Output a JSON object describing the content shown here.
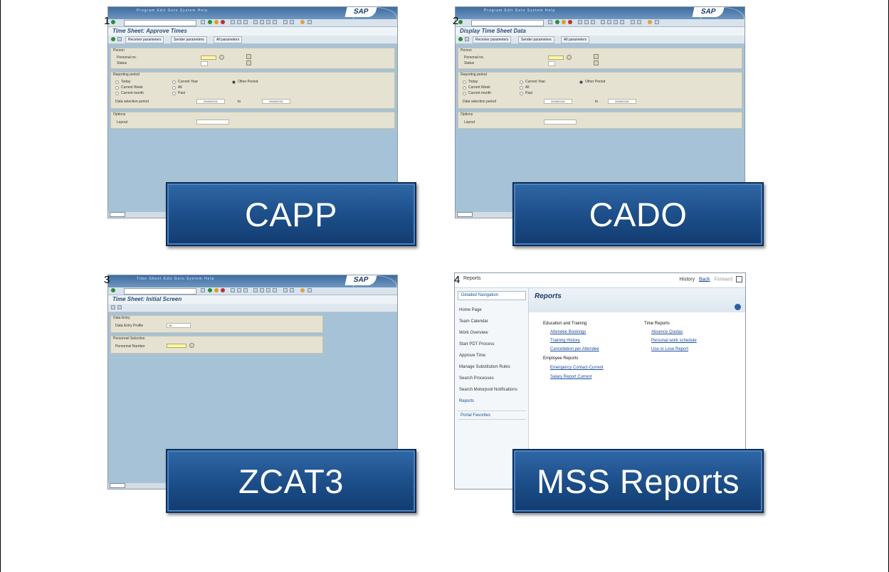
{
  "panels": [
    {
      "number": "1",
      "app": {
        "menu": "Program  Edit  Goto  System  Help",
        "logo": "SAP",
        "title": "Time Sheet: Approve Times",
        "buttons": [
          "Receiver parameters",
          "Sender parameters",
          "All parameters"
        ],
        "person_frame": "Person",
        "personal_no": "Personal no.",
        "status": "Status",
        "period_frame": "Reporting period",
        "options": [
          "Today",
          "Current Week",
          "Current month",
          "Current Year",
          "All",
          "Past",
          "Other Period"
        ],
        "selection_label": "Data selection period",
        "date_from": "09/26/2011",
        "to": "to",
        "date_to": "09/26/2011",
        "options_frame": "Options",
        "layout": "Layout"
      },
      "label": "CAPP"
    },
    {
      "number": "2",
      "app": {
        "menu": "Program  Edit  Goto  System  Help",
        "logo": "SAP",
        "title": "Display Time Sheet Data",
        "buttons": [
          "Receiver parameters",
          "Sender parameters",
          "All parameters"
        ],
        "person_frame": "Person",
        "personal_no": "Personal no.",
        "status": "Status",
        "period_frame": "Reporting period",
        "options": [
          "Today",
          "Current Week",
          "Current month",
          "Current Year",
          "All",
          "Past",
          "Other Period"
        ],
        "selection_label": "Data selection period",
        "date_from": "09/26/2011",
        "to": "to",
        "date_to": "09/26/2011",
        "options_frame": "Options",
        "layout": "Layout"
      },
      "label": "CADO"
    },
    {
      "number": "3",
      "app": {
        "menu": "Time Sheet  Edit  Goto  System  Help",
        "logo": "SAP",
        "title": "Time Sheet: Initial Screen",
        "entry_frame": "Data Entry",
        "profile_label": "Data Entry Profile",
        "profile_value": "08",
        "selection_frame": "Personnel Selection",
        "personnel_label": "Personnel Number"
      },
      "label": "ZCAT3"
    },
    {
      "number": "4",
      "portal": {
        "header_title": "Reports",
        "history": "History",
        "back": "Back",
        "forward": "Forward",
        "detailed_navigation": "Detailed Navigation",
        "nav": [
          "Home Page",
          "Team Calendar",
          "Work Overview",
          "Start PDT Process",
          "Approve Time",
          "Manage Substitution Rules",
          "Search Processes",
          "Search Motorpool Notifications",
          "Reports"
        ],
        "portal_favorites": "Portal Favorites",
        "main_title": "Reports",
        "edu_heading": "Education and Training",
        "edu_links": [
          "Attendee Bookings",
          "Training History",
          "Cancellation per Attendee"
        ],
        "emp_heading": "Employee Reports",
        "emp_links": [
          "Emergency Contact-Current",
          "Salary Report Current"
        ],
        "time_heading": "Time Reports",
        "time_links": [
          "Absence Quotas",
          "Personal work schedule",
          "Use or Lose Report"
        ]
      },
      "label": "MSS Reports"
    }
  ]
}
